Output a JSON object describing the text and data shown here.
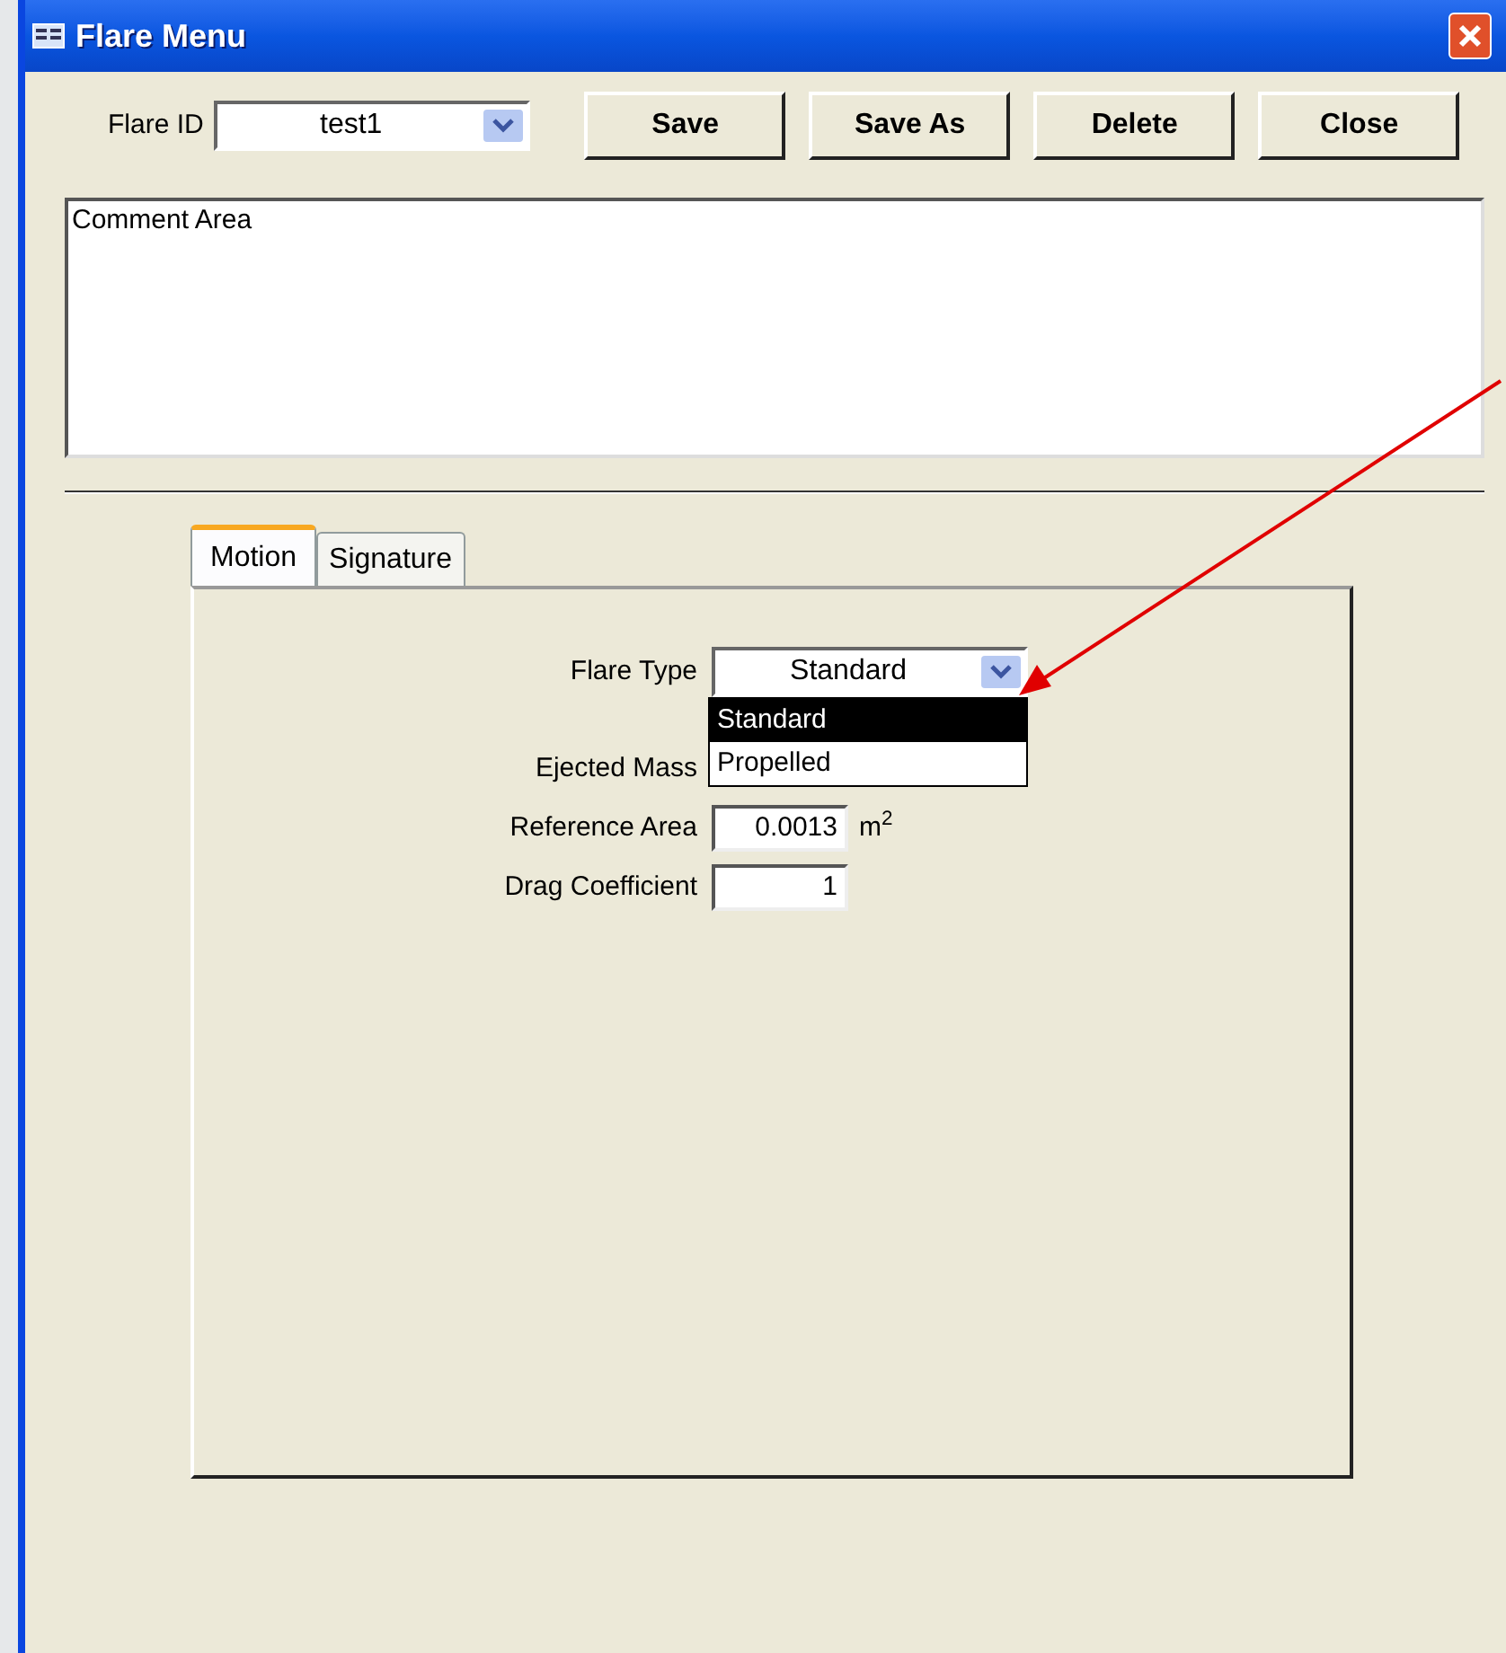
{
  "window": {
    "title": "Flare Menu"
  },
  "toolbar": {
    "flare_id": {
      "label": "Flare ID",
      "value": "test1"
    },
    "buttons": [
      "Save",
      "Save As",
      "Delete",
      "Close"
    ]
  },
  "comment": {
    "value": "Comment Area"
  },
  "tabs": [
    {
      "label": "Motion",
      "selected": true
    },
    {
      "label": "Signature",
      "selected": false
    }
  ],
  "motion": {
    "flare_type": {
      "label": "Flare Type",
      "value": "Standard",
      "expanded": true,
      "options": [
        {
          "label": "Standard",
          "selected": true
        },
        {
          "label": "Propelled",
          "selected": false
        }
      ]
    },
    "fields": [
      {
        "label": "Ejected Mass"
      },
      {
        "label": "Reference Area",
        "value": "0.0013",
        "unit": "m$^{2}$"
      },
      {
        "label": "Drag Coefficient",
        "value": "1"
      }
    ]
  }
}
